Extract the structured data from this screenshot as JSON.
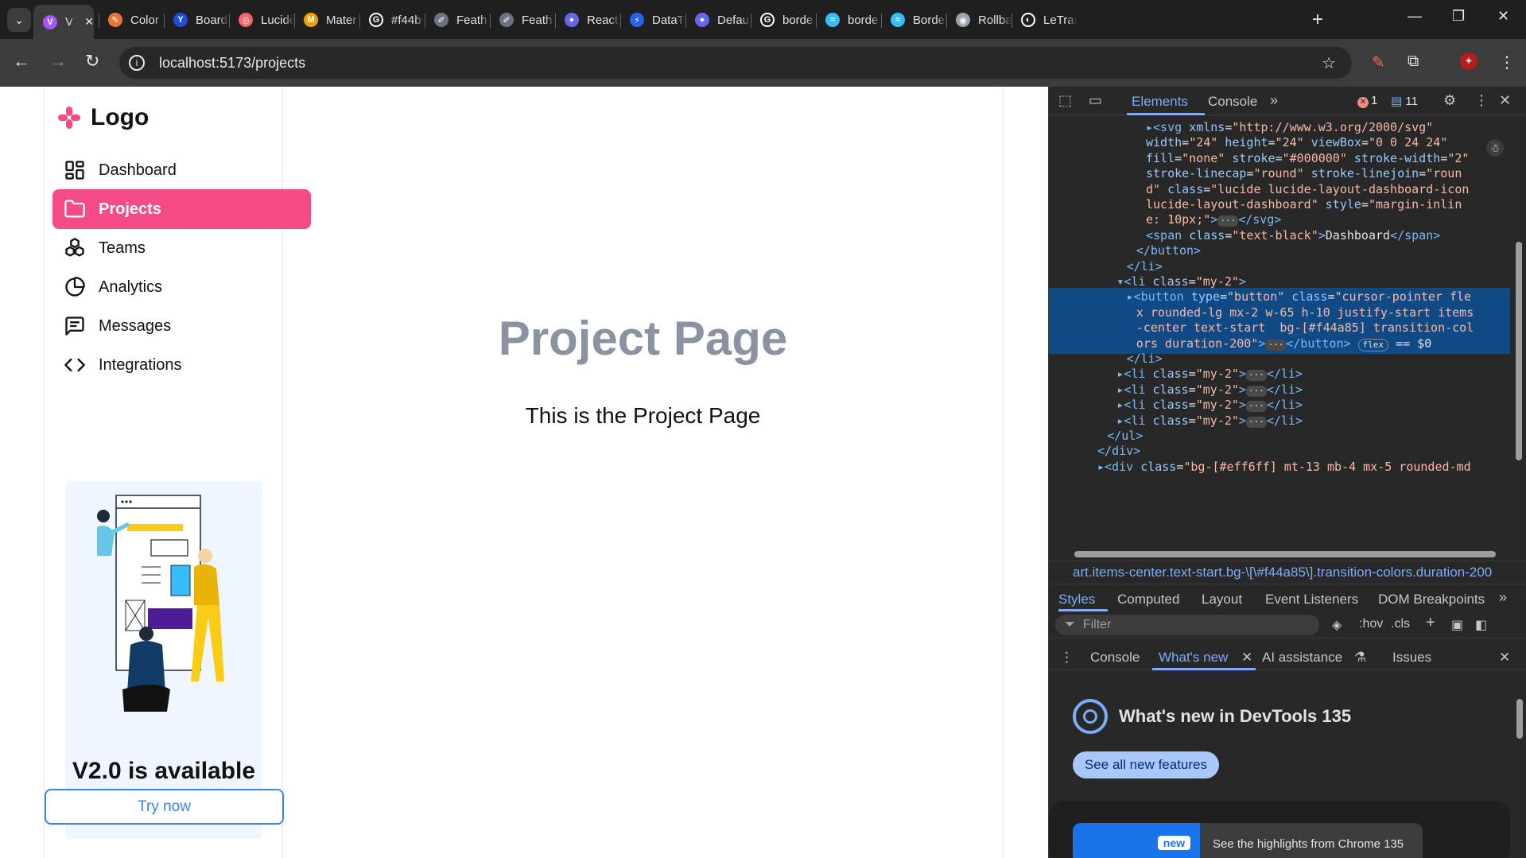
{
  "browser": {
    "tabs": [
      {
        "label": "Vi",
        "favicon_color": "#a855f7",
        "favicon_glyph": "V"
      },
      {
        "label": "Color",
        "favicon_color": "#e8743b",
        "favicon_glyph": "✎"
      },
      {
        "label": "Board",
        "favicon_color": "#1d4ed8",
        "favicon_glyph": "Y"
      },
      {
        "label": "Lucide",
        "favicon_color": "#f56565",
        "favicon_glyph": "◎"
      },
      {
        "label": "Mater",
        "favicon_color": "#f59e0b",
        "favicon_glyph": "M"
      },
      {
        "label": "#f44b",
        "favicon_color": "#ffffff",
        "favicon_glyph": "G"
      },
      {
        "label": "Feath",
        "favicon_color": "#6b7280",
        "favicon_glyph": "✐"
      },
      {
        "label": "Feath",
        "favicon_color": "#6b7280",
        "favicon_glyph": "✐"
      },
      {
        "label": "React",
        "favicon_color": "#6366f1",
        "favicon_glyph": "●"
      },
      {
        "label": "DataT",
        "favicon_color": "#2563eb",
        "favicon_glyph": "⚡"
      },
      {
        "label": "Defau",
        "favicon_color": "#6366f1",
        "favicon_glyph": "●"
      },
      {
        "label": "borde",
        "favicon_color": "#ffffff",
        "favicon_glyph": "G"
      },
      {
        "label": "borde",
        "favicon_color": "#38bdf8",
        "favicon_glyph": "≈"
      },
      {
        "label": "Borde",
        "favicon_color": "#38bdf8",
        "favicon_glyph": "≈"
      },
      {
        "label": "Rollba",
        "favicon_color": "#9ca3af",
        "favicon_glyph": "◉"
      },
      {
        "label": "LeTran",
        "favicon_color": "#ffffff",
        "favicon_glyph": "◐"
      }
    ],
    "url": "localhost:5173/projects",
    "icons": {
      "back": "arrow-left-icon",
      "forward": "arrow-right-icon",
      "reload": "reload-icon",
      "bookmark": "star-icon",
      "extensions": "puzzle-icon",
      "menu": "kebab-menu-icon"
    }
  },
  "app": {
    "logo_text": "Logo",
    "brand_color": "#f44a85",
    "nav": [
      {
        "label": "Dashboard",
        "icon": "layout-dashboard-icon",
        "active": false
      },
      {
        "label": "Projects",
        "icon": "folder-icon",
        "active": true
      },
      {
        "label": "Teams",
        "icon": "boxes-icon",
        "active": false
      },
      {
        "label": "Analytics",
        "icon": "pie-chart-icon",
        "active": false
      },
      {
        "label": "Messages",
        "icon": "message-square-icon",
        "active": false
      },
      {
        "label": "Integrations",
        "icon": "code-icon",
        "active": false
      }
    ],
    "promo": {
      "title": "V2.0 is available",
      "cta": "Try now"
    },
    "page": {
      "title": "Project Page",
      "subtitle": "This is the Project Page"
    }
  },
  "devtools": {
    "tabs": {
      "elements": "Elements",
      "console": "Console"
    },
    "error_count": "1",
    "message_count": "11",
    "dom_lines": [
      {
        "indent": 10,
        "html": "<span class=\"tag\">▸&lt;svg</span> <span class=\"attr\">xmlns</span>=<span class=\"aval\">\"http://www.w3.org/2000/svg\"</span>"
      },
      {
        "indent": 10,
        "html": "<span class=\"attr\">width</span>=<span class=\"aval\">\"24\"</span> <span class=\"attr\">height</span>=<span class=\"aval\">\"24\"</span> <span class=\"attr\">viewBox</span>=<span class=\"aval\">\"0 0 24 24\"</span>"
      },
      {
        "indent": 10,
        "html": "<span class=\"attr\">fill</span>=<span class=\"aval\">\"none\"</span> <span class=\"attr\">stroke</span>=<span class=\"aval\">\"#000000\"</span> <span class=\"attr\">stroke-width</span>=<span class=\"aval\">\"2\"</span>"
      },
      {
        "indent": 10,
        "html": "<span class=\"attr\">stroke-linecap</span>=<span class=\"aval\">\"round\"</span> <span class=\"attr\">stroke-linejoin</span>=<span class=\"aval\">\"roun</span>"
      },
      {
        "indent": 10,
        "html": "<span class=\"aval\">d\"</span> <span class=\"attr\">class</span>=<span class=\"aval\">\"lucide lucide-layout-dashboard-icon</span>"
      },
      {
        "indent": 10,
        "html": "<span class=\"aval\">lucide-layout-dashboard\"</span> <span class=\"attr\">style</span>=<span class=\"aval\">\"margin-inlin</span>"
      },
      {
        "indent": 10,
        "html": "<span class=\"aval\">e: 10px;\"</span><span class=\"tag\">&gt;</span><span class=\"ell\">···</span><span class=\"tag\">&lt;/svg&gt;</span>"
      },
      {
        "indent": 10,
        "html": "<span class=\"tag\">&lt;span</span> <span class=\"attr\">class</span>=<span class=\"aval\">\"text-black\"</span><span class=\"tag\">&gt;</span><span class=\"txt\">Dashboard</span><span class=\"tag\">&lt;/span&gt;</span>"
      },
      {
        "indent": 9,
        "html": "<span class=\"tag\">&lt;/button&gt;</span>"
      },
      {
        "indent": 8,
        "html": "<span class=\"tag\">&lt;/li&gt;</span>"
      },
      {
        "indent": 7,
        "html": "<span class=\"tag\">▾&lt;li</span> <span class=\"attr\">class</span>=<span class=\"aval\">\"my-2\"</span><span class=\"tag\">&gt;</span>"
      },
      {
        "indent": 8,
        "html": "<span class=\"tag\">▸&lt;button</span> <span class=\"attr\">type</span>=<span class=\"aval\">\"button\"</span> <span class=\"attr\">class</span>=<span class=\"aval\">\"cursor-pointer fle</span>",
        "sel": true
      },
      {
        "indent": 9,
        "html": "<span class=\"aval\">x rounded-lg mx-2 w-65 h-10 justify-start items</span>",
        "sel": true
      },
      {
        "indent": 9,
        "html": "<span class=\"aval\">-center text-start  bg-[#f44a85] transition-col</span>",
        "sel": true
      },
      {
        "indent": 9,
        "html": "<span class=\"aval\">ors duration-200\"</span><span class=\"tag\">&gt;</span><span class=\"ell\">···</span><span class=\"tag\">&lt;/button&gt;</span> <span class=\"flex-badge\">flex</span> <span class=\"txt\">== $0</span>",
        "sel": true
      },
      {
        "indent": 8,
        "html": "<span class=\"tag\">&lt;/li&gt;</span>"
      },
      {
        "indent": 7,
        "html": "<span class=\"tag\">▸&lt;li</span> <span class=\"attr\">class</span>=<span class=\"aval\">\"my-2\"</span><span class=\"tag\">&gt;</span><span class=\"ell\">···</span><span class=\"tag\">&lt;/li&gt;</span>"
      },
      {
        "indent": 7,
        "html": "<span class=\"tag\">▸&lt;li</span> <span class=\"attr\">class</span>=<span class=\"aval\">\"my-2\"</span><span class=\"tag\">&gt;</span><span class=\"ell\">···</span><span class=\"tag\">&lt;/li&gt;</span>"
      },
      {
        "indent": 7,
        "html": "<span class=\"tag\">▸&lt;li</span> <span class=\"attr\">class</span>=<span class=\"aval\">\"my-2\"</span><span class=\"tag\">&gt;</span><span class=\"ell\">···</span><span class=\"tag\">&lt;/li&gt;</span>"
      },
      {
        "indent": 7,
        "html": "<span class=\"tag\">▸&lt;li</span> <span class=\"attr\">class</span>=<span class=\"aval\">\"my-2\"</span><span class=\"tag\">&gt;</span><span class=\"ell\">···</span><span class=\"tag\">&lt;/li&gt;</span>"
      },
      {
        "indent": 6,
        "html": "<span class=\"tag\">&lt;/ul&gt;</span>"
      },
      {
        "indent": 5,
        "html": "<span class=\"tag\">&lt;/div&gt;</span>"
      },
      {
        "indent": 5,
        "html": "<span class=\"tag\">▸&lt;div</span> <span class=\"attr\">class</span>=<span class=\"aval\">\"bg-[#eff6ff] mt-13 mb-4 mx-5 rounded-md</span>"
      }
    ],
    "breadcrumb": "art.items-center.text-start.bg-\\[\\#f44a85\\].transition-colors.duration-200",
    "styles_tabs": [
      "Styles",
      "Computed",
      "Layout",
      "Event Listeners",
      "DOM Breakpoints"
    ],
    "filter_placeholder": "Filter",
    "filter_tools": [
      ":hov",
      ".cls"
    ],
    "drawer_tabs": [
      "Console",
      "What's new",
      "AI assistance",
      "Issues"
    ],
    "whats_new": {
      "title": "What's new in DevTools 135",
      "button": "See all new features",
      "badge": "new",
      "highlight": "See the highlights from Chrome 135"
    }
  }
}
